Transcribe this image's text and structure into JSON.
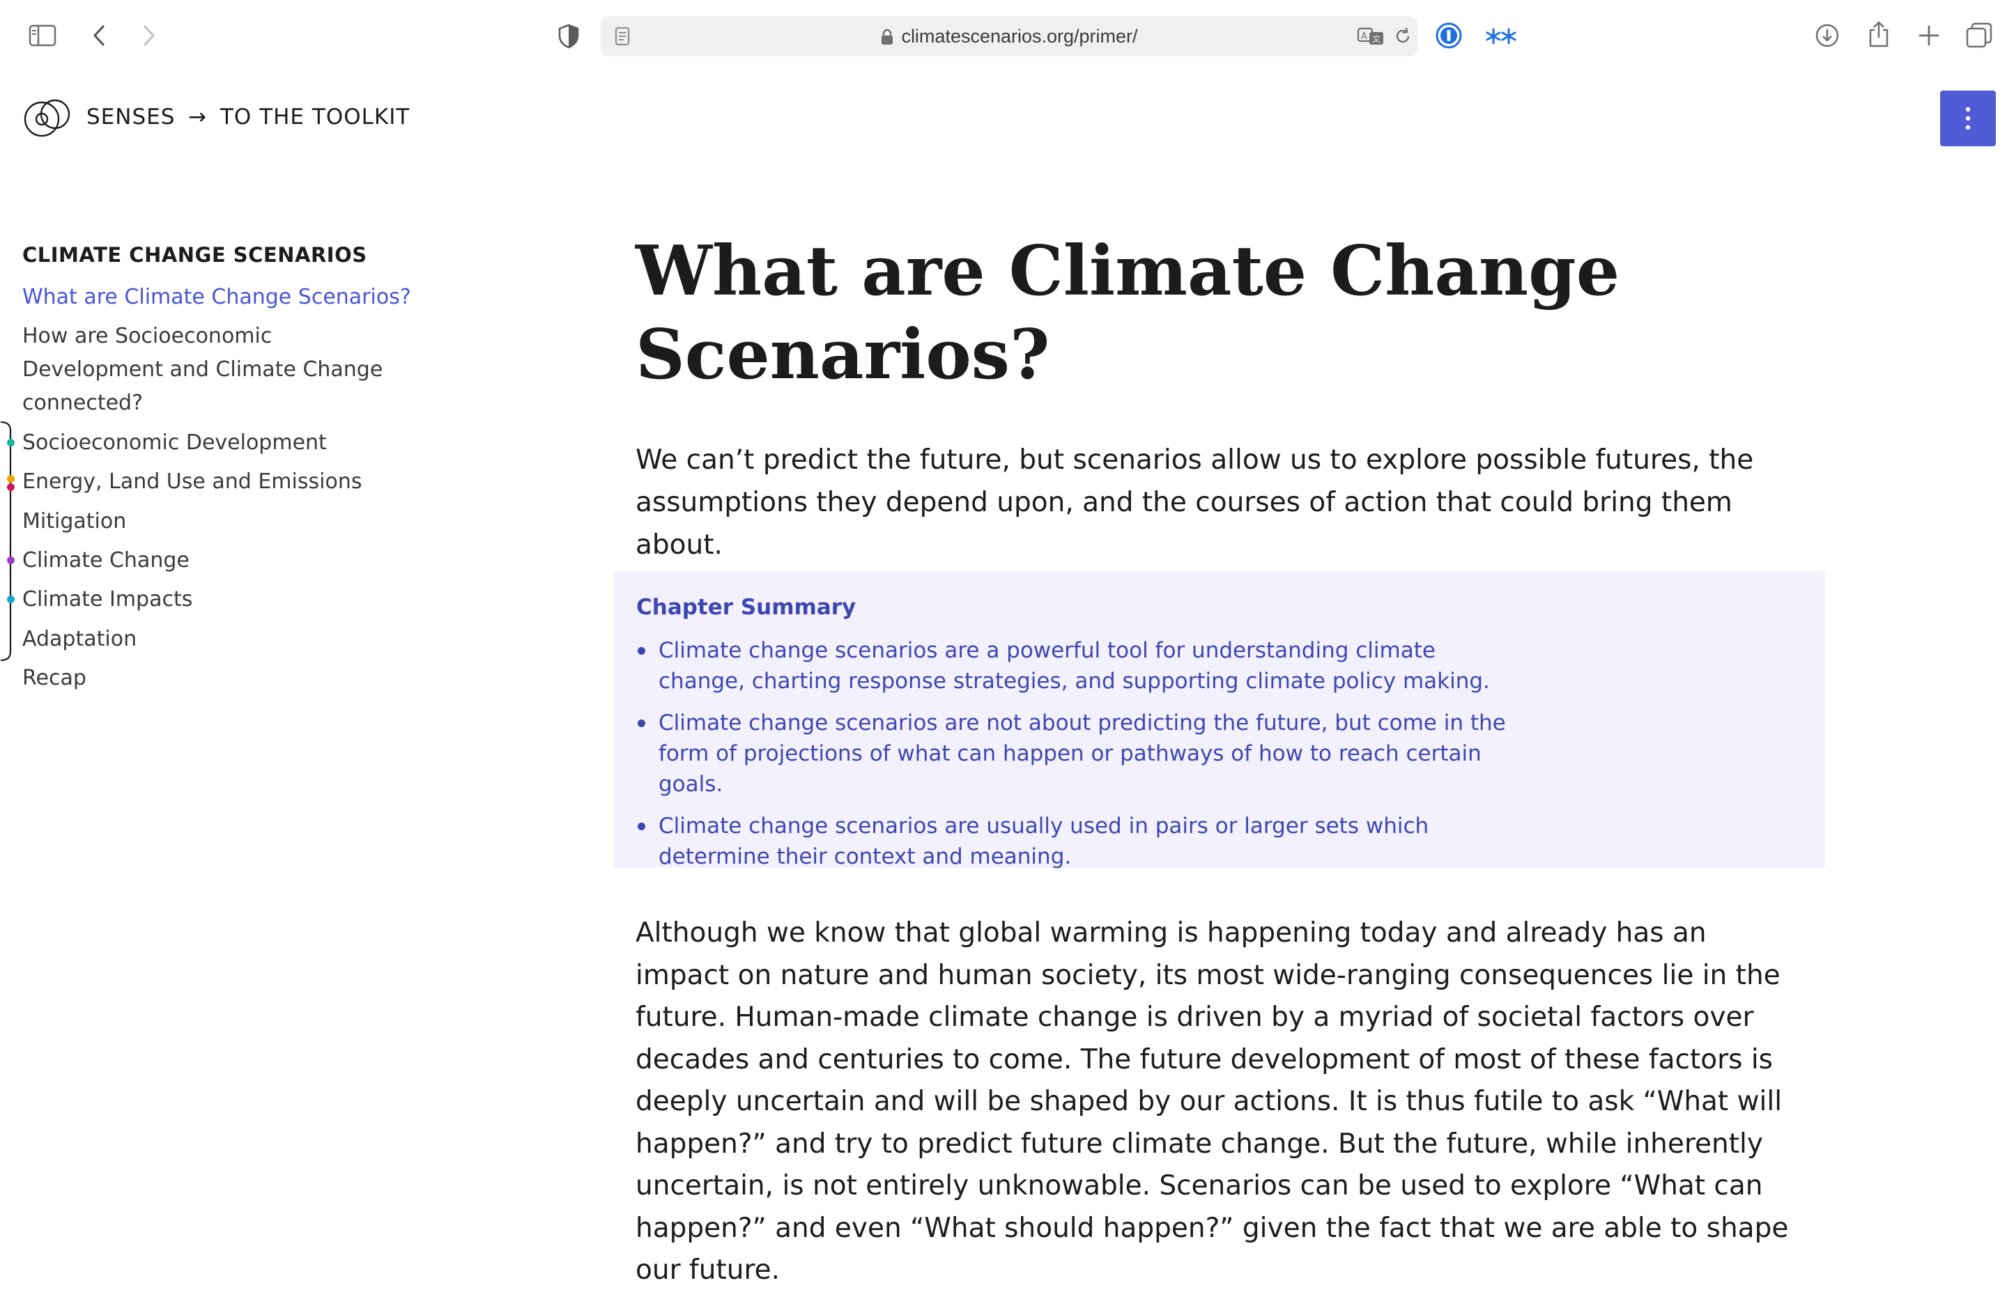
{
  "browser": {
    "url": "climatescenarios.org/primer/"
  },
  "header": {
    "brand": "SENSES",
    "arrow": "→",
    "toolkit_link": "TO THE TOOLKIT",
    "menu_icon": "⋮"
  },
  "sidebar": {
    "heading": "CLIMATE CHANGE SCENARIOS",
    "items": [
      {
        "label": "What are Climate Change Scenarios?",
        "active": true
      },
      {
        "label": "How are Socioeconomic Development and Climate Change connected?"
      },
      {
        "label": "Socioeconomic Development",
        "dot_color": "#17b59a"
      },
      {
        "label": "Energy, Land Use and Emissions",
        "dot_color": "#f0a500",
        "dot_color_2": "#d0185e"
      },
      {
        "label": "Mitigation"
      },
      {
        "label": "Climate Change",
        "dot_color": "#a23cc7"
      },
      {
        "label": "Climate Impacts",
        "dot_color": "#1aa7c8"
      },
      {
        "label": "Adaptation"
      },
      {
        "label": "Recap"
      }
    ]
  },
  "main": {
    "title": "What are Climate Change Scenarios?",
    "lead": "We can’t predict the future, but scenarios allow us to explore possible futures, the assump­tions they depend upon, and the courses of action that could bring them about.",
    "summary": {
      "title": "Chapter Summary",
      "points": [
        "Climate change scenarios are a powerful tool for understanding climate change, charting response strategies, and supporting climate policy making.",
        "Climate change scenarios are not about predicting the future, but come in the form of projections of what can happen or pathways of how to reach certain goals.",
        "Climate change scenarios are usually used in pairs or larger sets which determine their context and meaning."
      ]
    },
    "body": "Although we know that global warming is happening today and already has an impact on nature and human society, its most wide-ranging consequences lie in the future. Human-made climate change is driven by a myriad of societal factors over decades and centuries to come. The future development of most of these factors is deeply uncertain and will be shaped by our actions. It is thus futile to ask “What will happen?” and try to predict future climate change. But the future, while inherently uncertain, is not entirely unknowable. Sce­narios can be used to explore “What can happen?” and even “What should happen?” given the fact that we are able to shape our future."
  },
  "icons": {
    "sidebar_toggle": "sidebar-icon",
    "back": "chevron-left-icon",
    "forward": "chevron-right-icon",
    "privacy": "shield-icon",
    "page": "page-icon",
    "lock": "lock-icon",
    "translate": "translate-icon",
    "reload": "reload-icon",
    "password": "password-manager-icon",
    "extension": "extension-icon",
    "download": "download-icon",
    "share": "share-icon",
    "new_tab": "plus-icon",
    "tabs": "tabs-overview-icon"
  },
  "colors": {
    "accent": "#4a55d6",
    "menu_button": "#4f5bd5",
    "summary_bg": "#f2f1fd",
    "summary_text": "#3f46b0"
  }
}
